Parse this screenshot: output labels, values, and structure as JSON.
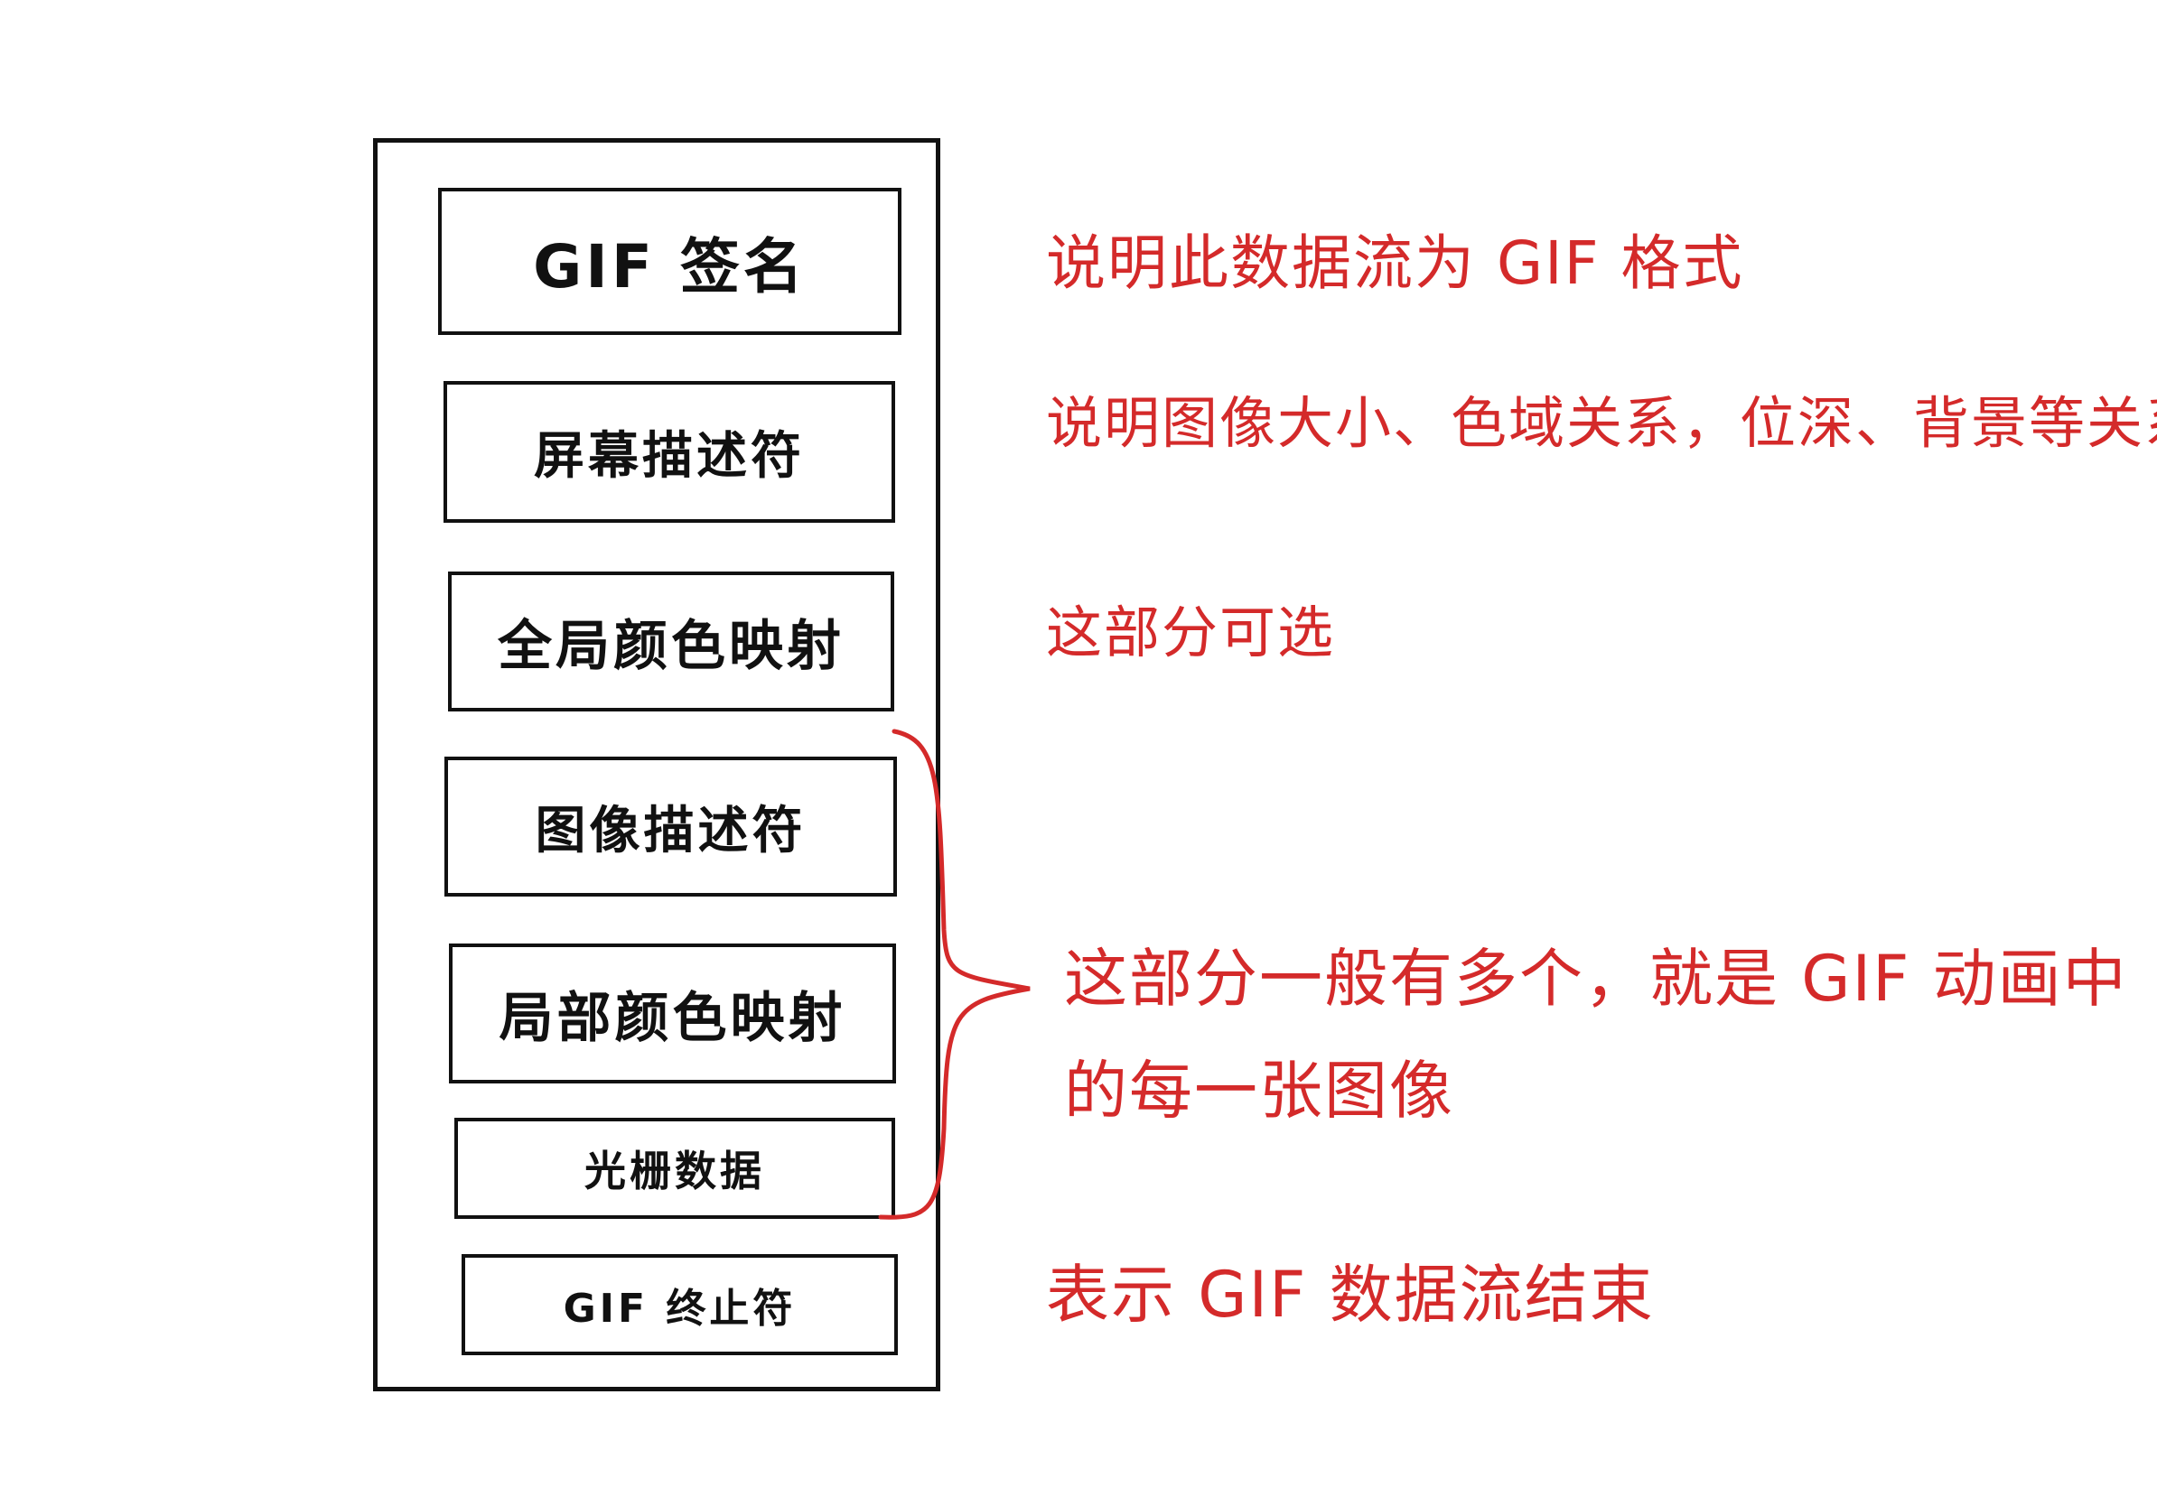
{
  "blocks": {
    "signature": "GIF 签名",
    "screen_descriptor": "屏幕描述符",
    "global_color_table": "全局颜色映射",
    "image_descriptor": "图像描述符",
    "local_color_table": "局部颜色映射",
    "raster_data": "光栅数据",
    "terminator": "GIF 终止符"
  },
  "notes": {
    "signature": "说明此数据流为 GIF 格式",
    "screen_descriptor": "说明图像大小、色域关系，位深、背景等关系",
    "global_color_table": "这部分可选",
    "image_frames": "这部分一般有多个，就是 GIF 动画中的每一张图像",
    "terminator": "表示 GIF 数据流结束"
  },
  "colors": {
    "block_stroke": "#111111",
    "annotation": "#d42a2a"
  }
}
